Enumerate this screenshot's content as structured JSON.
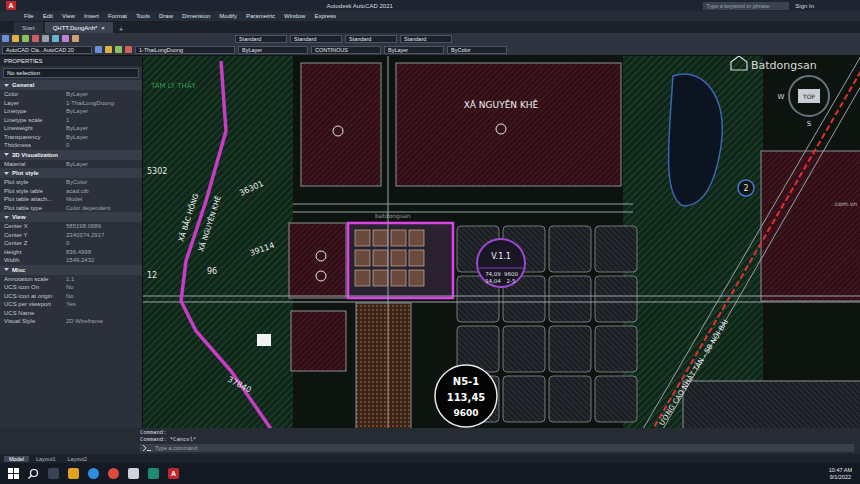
{
  "window": {
    "title": "Autodesk AutoCAD 2021",
    "app_logo": "A",
    "search_placeholder": "Type a keyword or phrase",
    "sign_in": "Sign In"
  },
  "menu": [
    "File",
    "Edit",
    "View",
    "Insert",
    "Format",
    "Tools",
    "Draw",
    "Dimension",
    "Modify",
    "Parametric",
    "Window",
    "Express"
  ],
  "doc_tabs": [
    {
      "label": "Start",
      "selected": false
    },
    {
      "label": "QHTT.DongAnh*",
      "selected": true
    }
  ],
  "tab_close": "×",
  "tab_add": "+",
  "toolbar": {
    "styles": [
      "Standard",
      "Standard",
      "Standard",
      "Standard"
    ],
    "workspace": "AutoCAD Cla...AutoCAD 20",
    "layer": "1-ThaiLongDuong",
    "color": "ByLayer",
    "linetype": "CONTINOUS",
    "lineweight": "ByLayer",
    "plot": "ByColor"
  },
  "properties": {
    "title": "PROPERTIES",
    "selection": "No selection",
    "sections": [
      {
        "title": "General",
        "expanded": true,
        "rows": [
          {
            "label": "Color",
            "value": "ByLayer"
          },
          {
            "label": "Layer",
            "value": "1-ThaiLongDuong"
          },
          {
            "label": "Linetype",
            "value": "ByLayer"
          },
          {
            "label": "Linetype scale",
            "value": "1"
          },
          {
            "label": "Lineweight",
            "value": "ByLayer"
          },
          {
            "label": "Transparency",
            "value": "ByLayer"
          },
          {
            "label": "Thickness",
            "value": "0"
          }
        ]
      },
      {
        "title": "3D Visualization",
        "expanded": true,
        "rows": [
          {
            "label": "Material",
            "value": "ByLayer"
          }
        ]
      },
      {
        "title": "Plot style",
        "expanded": true,
        "rows": [
          {
            "label": "Plot style",
            "value": "ByColor"
          },
          {
            "label": "Plot style table",
            "value": "acad.ctb"
          },
          {
            "label": "Plot table attach...",
            "value": "Model"
          },
          {
            "label": "Plot table type",
            "value": "Color dependent"
          }
        ]
      },
      {
        "title": "View",
        "expanded": true,
        "rows": [
          {
            "label": "Center X",
            "value": "585198.0686"
          },
          {
            "label": "Center Y",
            "value": "2340374.2917"
          },
          {
            "label": "Center Z",
            "value": "0"
          },
          {
            "label": "Height",
            "value": "836.4998"
          },
          {
            "label": "Width",
            "value": "1549.2432"
          }
        ]
      },
      {
        "title": "Misc",
        "expanded": true,
        "rows": [
          {
            "label": "Annotation scale",
            "value": "1:1"
          },
          {
            "label": "UCS icon On",
            "value": "No"
          },
          {
            "label": "UCS icon at origin",
            "value": "No"
          },
          {
            "label": "UCS per viewport",
            "value": "Yes"
          },
          {
            "label": "UCS Name"
          },
          {
            "label": "Visual Style",
            "value": "2D Wireframe"
          }
        ]
      }
    ]
  },
  "canvas": {
    "commune_top": "XÃ NGUYÊN KHÊ",
    "boundary_left": "XÃ BẮC HỒNG",
    "boundary_right": "XÃ NGUYÊN KHÊ",
    "parcel_numbers": [
      "5302",
      "36301",
      "39114",
      "96",
      "12",
      "37840"
    ],
    "plot_v": {
      "name": "V.1.1",
      "area": "74,09",
      "height": "9600",
      "density": "14,04",
      "floors": "2-5"
    },
    "plot_n": {
      "name": "N5-1",
      "area": "113,45",
      "height": "9600"
    },
    "road": "ƯỜNG CAO NHẬT TÂN - SB NỘI BÀI",
    "route_marker": "2",
    "viewcube": {
      "west": "W",
      "top": "TOP",
      "south": "S"
    },
    "watermarks": {
      "brand": "Batdongsan",
      "brand_suffix": ".com.vn",
      "center": "batdongsan",
      "left": "TÂM LÝ THẦY"
    }
  },
  "command": {
    "history": [
      "Command:",
      "Command: *Cancel*"
    ],
    "placeholder": "Type a command"
  },
  "layout_tabs": [
    {
      "label": "Model",
      "selected": true
    },
    {
      "label": "Layout1",
      "selected": false
    },
    {
      "label": "Layout2",
      "selected": false
    }
  ],
  "taskbar": {
    "time": "10:47 AM",
    "date": "9/1/2022"
  }
}
